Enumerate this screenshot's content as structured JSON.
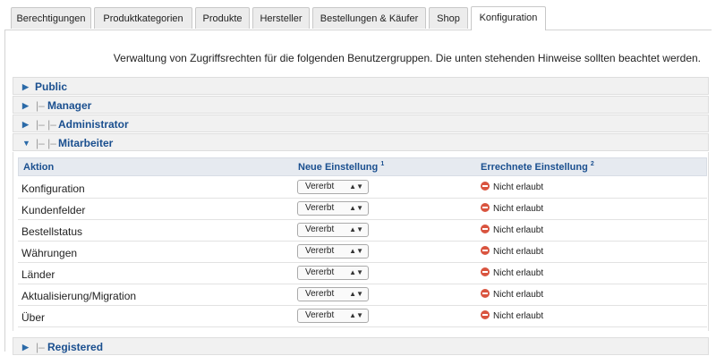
{
  "tabs": [
    "Berechtigungen",
    "Produktkategorien",
    "Produkte",
    "Hersteller",
    "Bestellungen & Käufer",
    "Shop",
    "Konfiguration"
  ],
  "intro": "Verwaltung von Zugriffsrechten für die folgenden Benutzergruppen. Die unten stehenden Hinweise sollten beachtet werden.",
  "groups": [
    {
      "name": "Public",
      "prefix": "",
      "expanded": false
    },
    {
      "name": "Manager",
      "prefix": "|–",
      "expanded": false
    },
    {
      "name": "Administrator",
      "prefix": "|– |–",
      "expanded": false
    },
    {
      "name": "Mitarbeiter",
      "prefix": "|– |–",
      "expanded": true
    },
    {
      "name": "Registered",
      "prefix": "|–",
      "expanded": false
    }
  ],
  "table": {
    "headers": {
      "action": "Aktion",
      "new_setting": "Neue Einstellung",
      "new_setting_note": "1",
      "computed_setting": "Errechnete Einstellung",
      "computed_setting_note": "2"
    },
    "rows": [
      {
        "action": "Konfiguration",
        "setting": "Vererbt",
        "computed": "Nicht erlaubt"
      },
      {
        "action": "Kundenfelder",
        "setting": "Vererbt",
        "computed": "Nicht erlaubt"
      },
      {
        "action": "Bestellstatus",
        "setting": "Vererbt",
        "computed": "Nicht erlaubt"
      },
      {
        "action": "Währungen",
        "setting": "Vererbt",
        "computed": "Nicht erlaubt"
      },
      {
        "action": "Länder",
        "setting": "Vererbt",
        "computed": "Nicht erlaubt"
      },
      {
        "action": "Aktualisierung/Migration",
        "setting": "Vererbt",
        "computed": "Nicht erlaubt"
      },
      {
        "action": "Über",
        "setting": "Vererbt",
        "computed": "Nicht erlaubt"
      }
    ]
  },
  "icons": {
    "expanded": "triangle-down-icon",
    "collapsed": "triangle-right-icon",
    "denied": "deny-icon"
  },
  "colors": {
    "link": "#1a4f8f",
    "deny": "#d9543f",
    "header_bg": "#e6eaf0",
    "group_bg": "#f1f1f1"
  }
}
